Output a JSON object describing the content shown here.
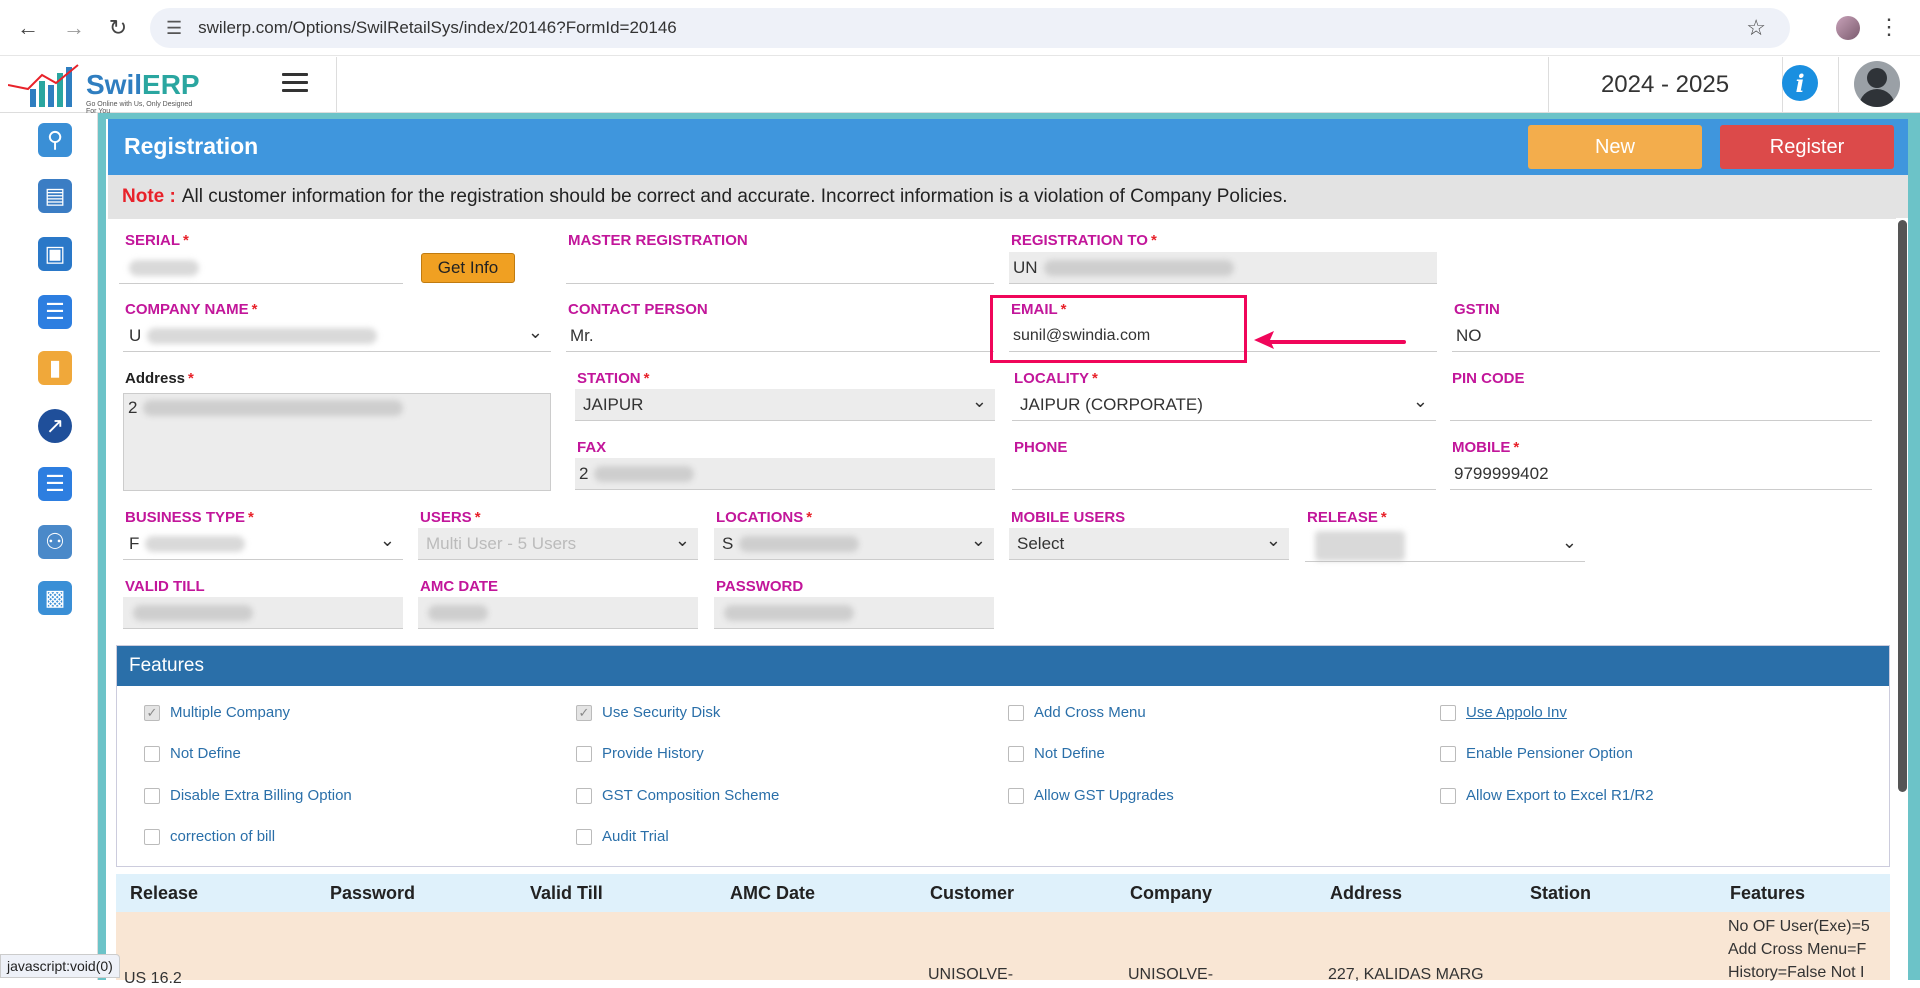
{
  "browser": {
    "url": "swilerp.com/Options/SwilRetailSys/index/20146?FormId=20146"
  },
  "app": {
    "logo_text_a": "Swil",
    "logo_text_b": "ERP",
    "logo_tagline": "Go Online with Us, Only Designed For You",
    "financial_year": "2024 - 2025"
  },
  "page": {
    "title": "Registration",
    "new_label": "New",
    "register_label": "Register",
    "note_label": "Note :",
    "note_text": "All customer information for the registration should be correct and accurate. Incorrect information is a violation of Company Policies."
  },
  "form": {
    "serial_label": "SERIAL",
    "get_info_label": "Get Info",
    "master_registration_label": "MASTER REGISTRATION",
    "registration_to_label": "REGISTRATION TO",
    "registration_to_value": "UN",
    "company_name_label": "COMPANY NAME",
    "company_name_value": "U",
    "contact_person_label": "CONTACT PERSON",
    "contact_person_value": "Mr.",
    "email_label": "EMAIL",
    "email_value": "sunil@swindia.com",
    "gstin_label": "GSTIN",
    "gstin_value": "NO",
    "address_label": "Address",
    "address_value": "2",
    "station_label": "STATION",
    "station_value": "JAIPUR",
    "locality_label": "LOCALITY",
    "locality_value": "JAIPUR (CORPORATE)",
    "pin_code_label": "PIN CODE",
    "fax_label": "FAX",
    "fax_value": "2",
    "phone_label": "PHONE",
    "mobile_label": "MOBILE",
    "mobile_value": "9799999402",
    "business_type_label": "BUSINESS TYPE",
    "business_type_value": "F",
    "users_label": "USERS",
    "users_value": "Multi User - 5 Users",
    "locations_label": "LOCATIONS",
    "locations_value": "S",
    "mobile_users_label": "MOBILE USERS",
    "mobile_users_value": "Select",
    "release_label": "RELEASE",
    "valid_till_label": "VALID TILL",
    "amc_date_label": "AMC DATE",
    "password_label": "PASSWORD"
  },
  "features": {
    "title": "Features",
    "items": [
      {
        "label": "Multiple Company",
        "checked": true
      },
      {
        "label": "Use Security Disk",
        "checked": true
      },
      {
        "label": "Add Cross Menu",
        "checked": false
      },
      {
        "label": "Use Appolo Inv",
        "checked": false
      },
      {
        "label": "Not Define",
        "checked": false
      },
      {
        "label": "Provide History",
        "checked": false
      },
      {
        "label": "Not Define",
        "checked": false
      },
      {
        "label": "Enable Pensioner Option",
        "checked": false
      },
      {
        "label": "Disable Extra Billing Option",
        "checked": false
      },
      {
        "label": "GST Composition Scheme",
        "checked": false
      },
      {
        "label": "Allow GST Upgrades",
        "checked": false
      },
      {
        "label": "Allow Export to Excel R1/R2",
        "checked": false
      },
      {
        "label": "correction of bill",
        "checked": false
      },
      {
        "label": "Audit Trial",
        "checked": false
      }
    ]
  },
  "grid": {
    "columns": [
      "Release",
      "Password",
      "Valid Till",
      "AMC Date",
      "Customer",
      "Company",
      "Address",
      "Station",
      "Features"
    ],
    "row": {
      "release": "US 16.2",
      "customer": "UNISOLVE-",
      "company": "UNISOLVE-",
      "address": "227, KALIDAS MARG",
      "features_line1": "No OF User(Exe)=5",
      "features_line2": "Add Cross Menu=F",
      "features_line3": "History=False Not I"
    }
  },
  "status_bar": {
    "text": "javascript:void(0)"
  }
}
